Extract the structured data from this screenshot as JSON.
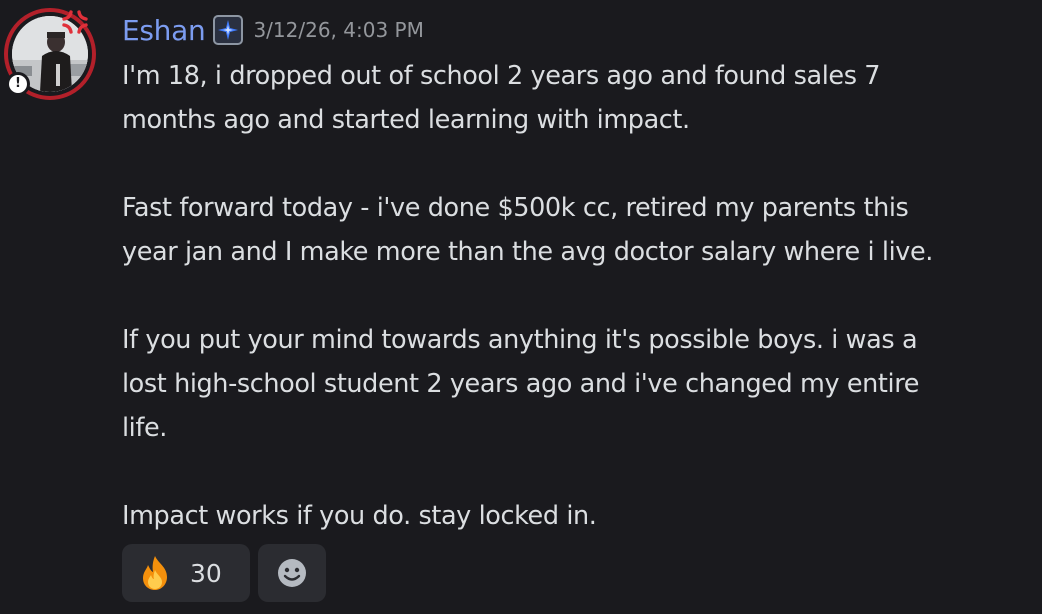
{
  "message": {
    "author": "Eshan",
    "timestamp": "3/12/26, 4:03 PM",
    "paragraphs": [
      "I'm 18, i dropped out of school 2 years ago and found sales 7\nmonths ago and started learning with impact.",
      "Fast forward today - i've done $500k cc, retired my parents this\nyear jan and I make more than the avg doctor salary where i live.",
      "If you put your mind towards anything it's possible boys. i was a\nlost high-school student 2 years ago and i've changed my entire\nlife.",
      "Impact works if you do. stay locked in."
    ],
    "avatar_status_glyph": "!"
  },
  "reactions": [
    {
      "emoji": "fire-icon",
      "count": "30"
    },
    {
      "emoji": "add-reaction-icon"
    }
  ],
  "colors": {
    "background": "#1a1a1e",
    "username": "#7c9cf0",
    "text": "#dbdee1",
    "timestamp": "#94979c",
    "reaction_bg": "#2b2c31",
    "avatar_ring": "#b3202a"
  }
}
